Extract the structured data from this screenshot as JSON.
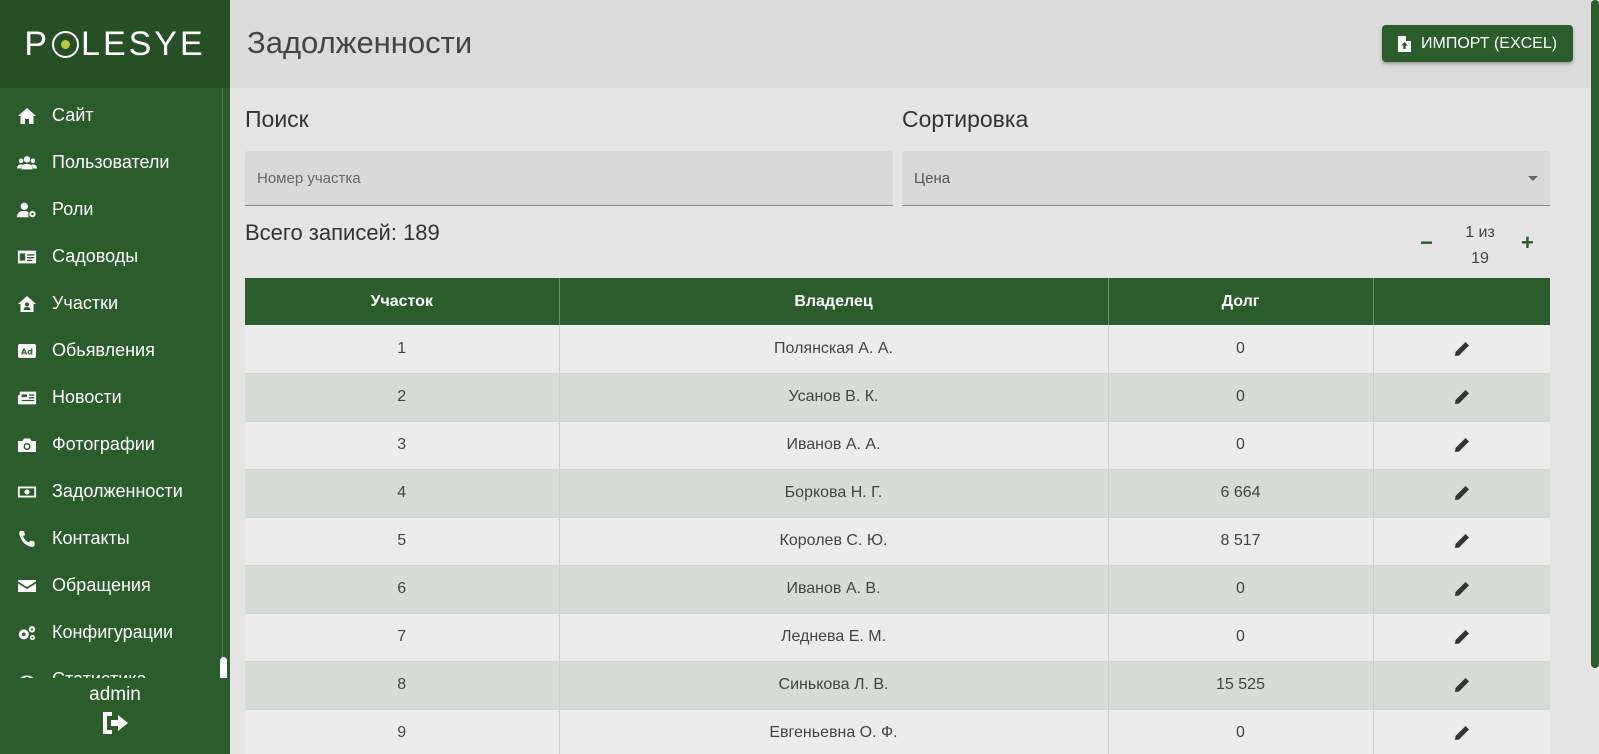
{
  "brand": {
    "logo_pre": "P",
    "logo_post": "LESYE"
  },
  "sidebar": {
    "items": [
      {
        "label": "Сайт",
        "icon": "home-icon"
      },
      {
        "label": "Пользователи",
        "icon": "users-icon"
      },
      {
        "label": "Роли",
        "icon": "user-cog-icon"
      },
      {
        "label": "Садоводы",
        "icon": "id-card-icon"
      },
      {
        "label": "Участки",
        "icon": "house-user-icon"
      },
      {
        "label": "Обьявления",
        "icon": "ad-icon"
      },
      {
        "label": "Новости",
        "icon": "newspaper-icon"
      },
      {
        "label": "Фотографии",
        "icon": "camera-icon"
      },
      {
        "label": "Задолженности",
        "icon": "money-bill-icon"
      },
      {
        "label": "Контакты",
        "icon": "phone-icon"
      },
      {
        "label": "Обращения",
        "icon": "envelope-icon"
      },
      {
        "label": "Конфигурации",
        "icon": "cogs-icon"
      },
      {
        "label": "Статистика",
        "icon": "eye-icon"
      }
    ],
    "user": "admin"
  },
  "header": {
    "title": "Задолженности",
    "import_label": "ИМПОРТ (EXCEL)"
  },
  "search": {
    "label": "Поиск",
    "placeholder": "Номер участка"
  },
  "sort": {
    "label": "Сортировка",
    "value": "Цена"
  },
  "total_label": "Всего записей: 189",
  "pager": {
    "line1": "1 из",
    "line2": "19",
    "prev": "−",
    "next": "+"
  },
  "table": {
    "headers": [
      "Участок",
      "Владелец",
      "Долг",
      ""
    ],
    "rows": [
      [
        "1",
        "Полянская А. А.",
        "0"
      ],
      [
        "2",
        "Усанов В. К.",
        "0"
      ],
      [
        "3",
        "Иванов А. А.",
        "0"
      ],
      [
        "4",
        "Боркова Н. Г.",
        "6 664"
      ],
      [
        "5",
        "Королев С. Ю.",
        "8 517"
      ],
      [
        "6",
        "Иванов А. В.",
        "0"
      ],
      [
        "7",
        "Леднева Е. М.",
        "0"
      ],
      [
        "8",
        "Синькова Л. В.",
        "15 525"
      ],
      [
        "9",
        "Евгеньевна О. Ф.",
        "0"
      ]
    ]
  },
  "colors": {
    "primary": "#2b5c2b",
    "accent_dot": "#b8c83a"
  }
}
